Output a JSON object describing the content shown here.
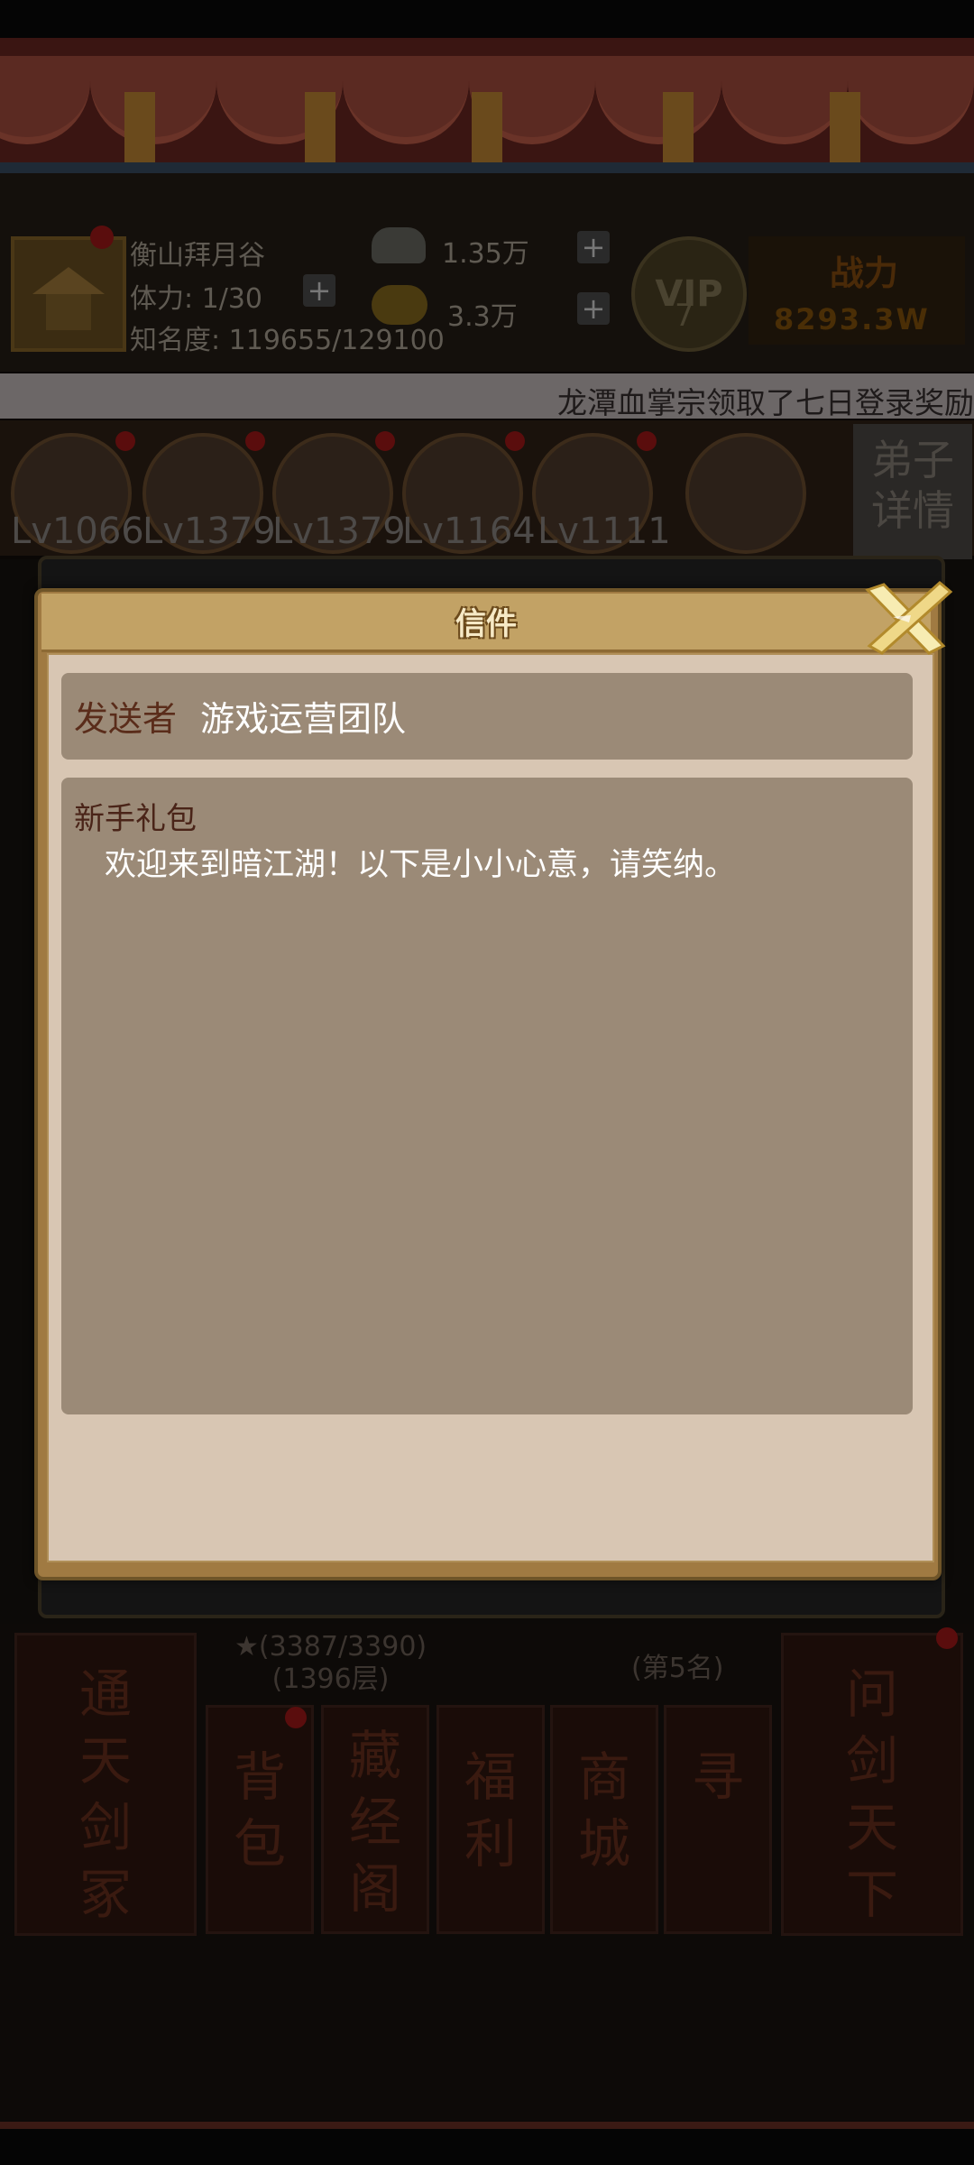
{
  "header": {
    "sect_name": "衡山拜月谷",
    "stamina": "体力: 1/30",
    "fame": "知名度: 119655/129100",
    "silver": "1.35万",
    "gold": "3.3万",
    "vip_label": "VIP",
    "vip_level": "7",
    "power_label": "战力",
    "power_value": "8293.3W"
  },
  "ticker": {
    "text": "龙潭血掌宗领取了七日登录奖励"
  },
  "disciples": {
    "levels": [
      "Lv1066",
      "Lv1379",
      "Lv1379",
      "Lv1164",
      "Lv1111"
    ],
    "detail_button": "弟子详情"
  },
  "bottom_menu": {
    "star_progress": "★(3387/3390)",
    "floor": "(1396层)",
    "rank": "(第5名)",
    "left_card": "通天剑冢",
    "right_card": "问剑天下",
    "items": [
      "背包",
      "藏经阁",
      "福利",
      "商城",
      "寻"
    ]
  },
  "dialog": {
    "title": "信件",
    "sender_label": "发送者",
    "sender_value": "游戏运营团队",
    "content_title": "新手礼包",
    "content_text": "欢迎来到暗江湖！以下是小小心意，请笑纳。",
    "close_icon": "close-x-icon"
  },
  "colors": {
    "dialog_frame": "#a07a42",
    "dialog_body": "#d8c6b3",
    "content_box": "#9b8a77",
    "title_text": "#f6e9c6",
    "sender_label": "#5a2c1a"
  }
}
